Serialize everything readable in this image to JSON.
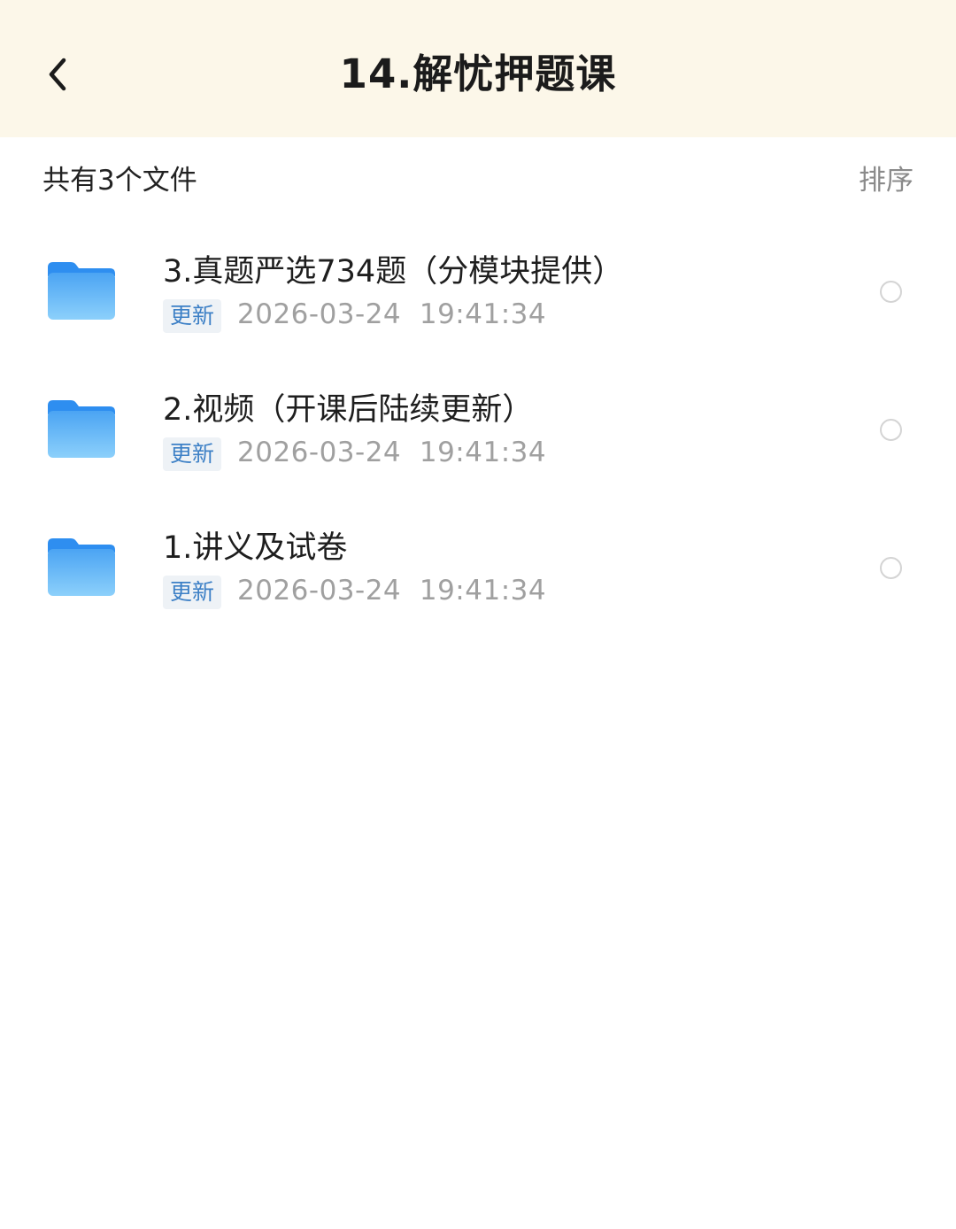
{
  "header": {
    "title": "14.解忧押题课",
    "back_icon": "chevron-left-icon"
  },
  "summary": {
    "count_text": "共有3个文件",
    "sort_label": "排序"
  },
  "files": [
    {
      "name": "3.真题严选734题（分模块提供）",
      "tag": "更新",
      "time": "2026-03-24  19:41:34",
      "icon": "folder-icon"
    },
    {
      "name": "2.视频（开课后陆续更新）",
      "tag": "更新",
      "time": "2026-03-24  19:41:34",
      "icon": "folder-icon"
    },
    {
      "name": "1.讲义及试卷",
      "tag": "更新",
      "time": "2026-03-24  19:41:34",
      "icon": "folder-icon"
    }
  ],
  "colors": {
    "header_bg": "#fcf7e9",
    "folder_blue": "#4aa8f5",
    "badge_text": "#3d80c6",
    "badge_bg": "#eef2f6"
  }
}
